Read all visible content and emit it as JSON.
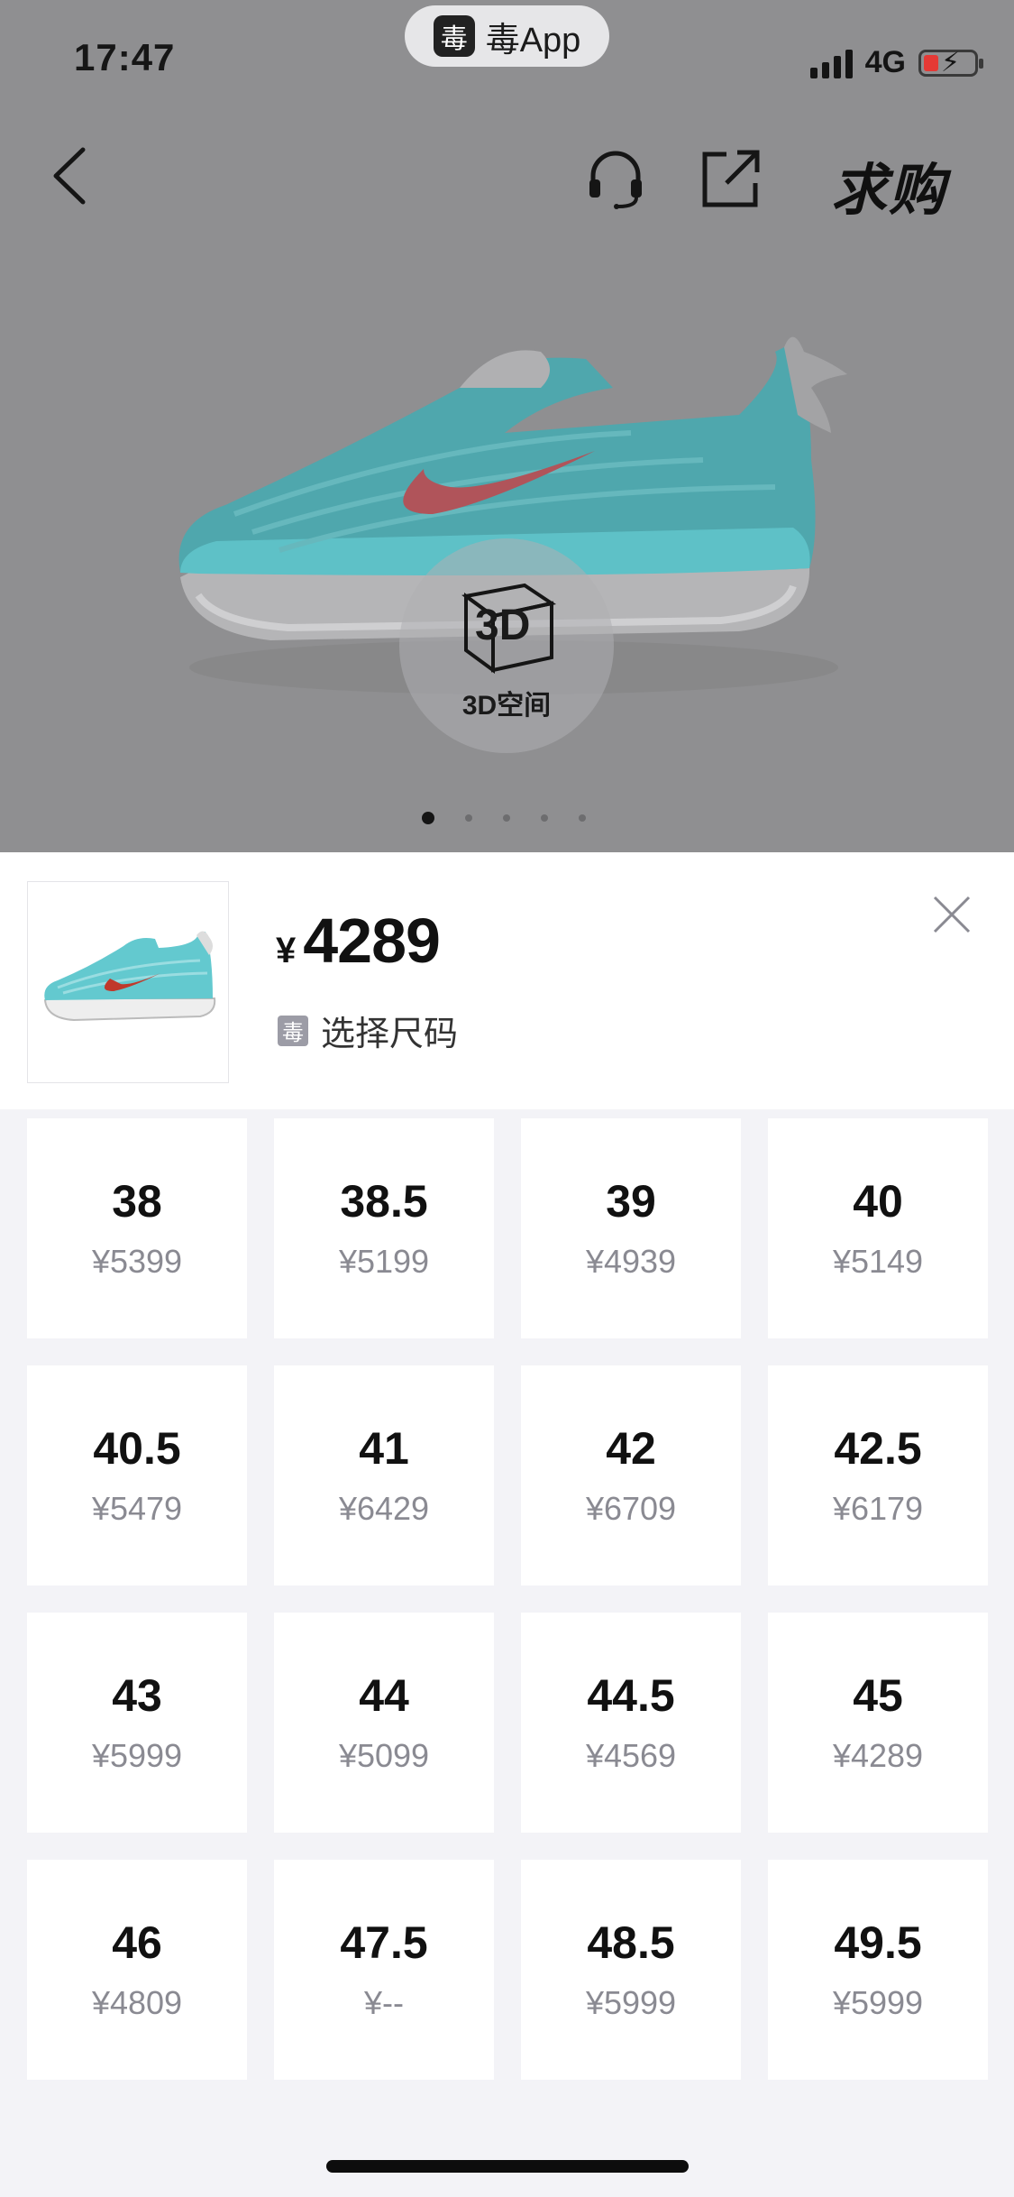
{
  "status_bar": {
    "time": "17:47",
    "app_pill_icon": "毒",
    "app_pill_label": "毒App",
    "network": "4G"
  },
  "top_nav": {
    "back_icon": "chevron-left-icon",
    "service_icon": "headset-icon",
    "share_icon": "share-icon",
    "buy_label": "求购"
  },
  "hero": {
    "view_3d_label": "3D空间",
    "pager": {
      "count": 5,
      "active": 1
    }
  },
  "sheet": {
    "currency": "¥",
    "price": "4289",
    "select_icon": "毒",
    "select_label": "选择尺码",
    "close_icon": "close-icon"
  },
  "sizes": [
    {
      "size": "38",
      "price": "¥5399"
    },
    {
      "size": "38.5",
      "price": "¥5199"
    },
    {
      "size": "39",
      "price": "¥4939"
    },
    {
      "size": "40",
      "price": "¥5149"
    },
    {
      "size": "40.5",
      "price": "¥5479"
    },
    {
      "size": "41",
      "price": "¥6429"
    },
    {
      "size": "42",
      "price": "¥6709"
    },
    {
      "size": "42.5",
      "price": "¥6179"
    },
    {
      "size": "43",
      "price": "¥5999"
    },
    {
      "size": "44",
      "price": "¥5099"
    },
    {
      "size": "44.5",
      "price": "¥4569"
    },
    {
      "size": "45",
      "price": "¥4289"
    },
    {
      "size": "46",
      "price": "¥4809"
    },
    {
      "size": "47.5",
      "price": "¥--"
    },
    {
      "size": "48.5",
      "price": "¥5999"
    },
    {
      "size": "49.5",
      "price": "¥5999"
    }
  ],
  "colors": {
    "overlay": "#8f8f91",
    "grid_bg": "#f3f3f7",
    "shoe_teal": "#5fc6cc",
    "swoosh_red": "#c0392b"
  }
}
